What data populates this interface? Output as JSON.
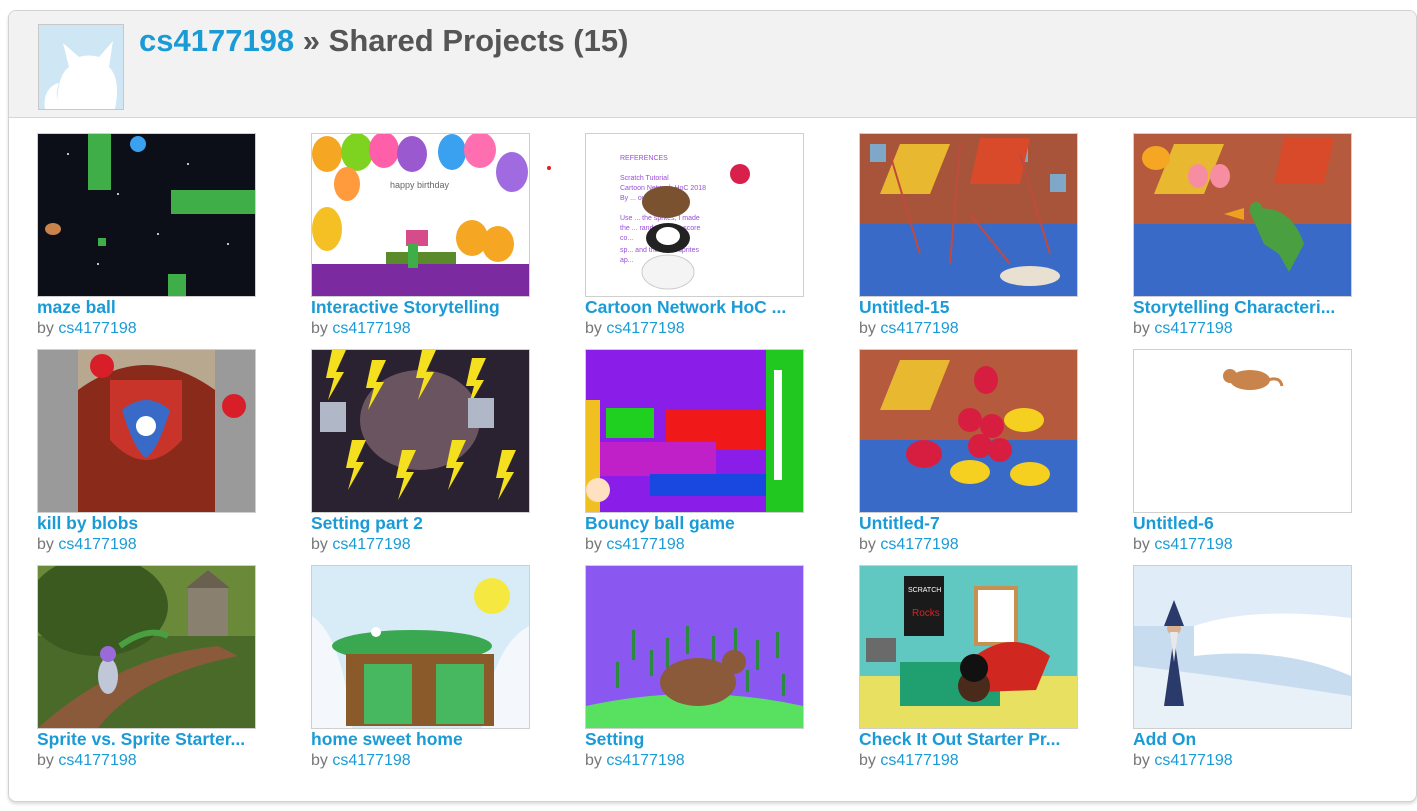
{
  "header": {
    "username": "cs4177198",
    "separator": " » ",
    "section_title": "Shared Projects (15)",
    "avatar_icon": "scratch-cat-avatar-icon"
  },
  "byline_prefix": "by ",
  "projects": [
    {
      "title": "maze ball",
      "author": "cs4177198"
    },
    {
      "title": "Interactive Storytelling",
      "author": "cs4177198"
    },
    {
      "title": "Cartoon Network HoC ...",
      "author": "cs4177198"
    },
    {
      "title": "Untitled-15",
      "author": "cs4177198"
    },
    {
      "title": "Storytelling Characteri...",
      "author": "cs4177198"
    },
    {
      "title": "kill by blobs",
      "author": "cs4177198"
    },
    {
      "title": "Setting part 2",
      "author": "cs4177198"
    },
    {
      "title": "Bouncy ball game",
      "author": "cs4177198"
    },
    {
      "title": "Untitled-7",
      "author": "cs4177198"
    },
    {
      "title": "Untitled-6",
      "author": "cs4177198"
    },
    {
      "title": "Sprite vs. Sprite Starter...",
      "author": "cs4177198"
    },
    {
      "title": "home sweet home",
      "author": "cs4177198"
    },
    {
      "title": "Setting",
      "author": "cs4177198"
    },
    {
      "title": "Check It Out Starter Pr...",
      "author": "cs4177198"
    },
    {
      "title": "Add On",
      "author": "cs4177198"
    }
  ],
  "thumbnail_text": {
    "birthday": "happy birthday",
    "references": [
      "REFERENCES",
      "Scratch Tutorial",
      "Cartoon Network HoC 2018",
      "By ... ources",
      "Use ... the sprites, I made",
      "the ... randomly, the score",
      "co...",
      "sp... and the other sprites",
      "ap..."
    ],
    "poster": "SCRATCH",
    "poster2": "Rocks"
  },
  "colors": {
    "link": "#1a9bd6",
    "title_gray": "#555555",
    "header_bg": "#f2f2f2"
  }
}
